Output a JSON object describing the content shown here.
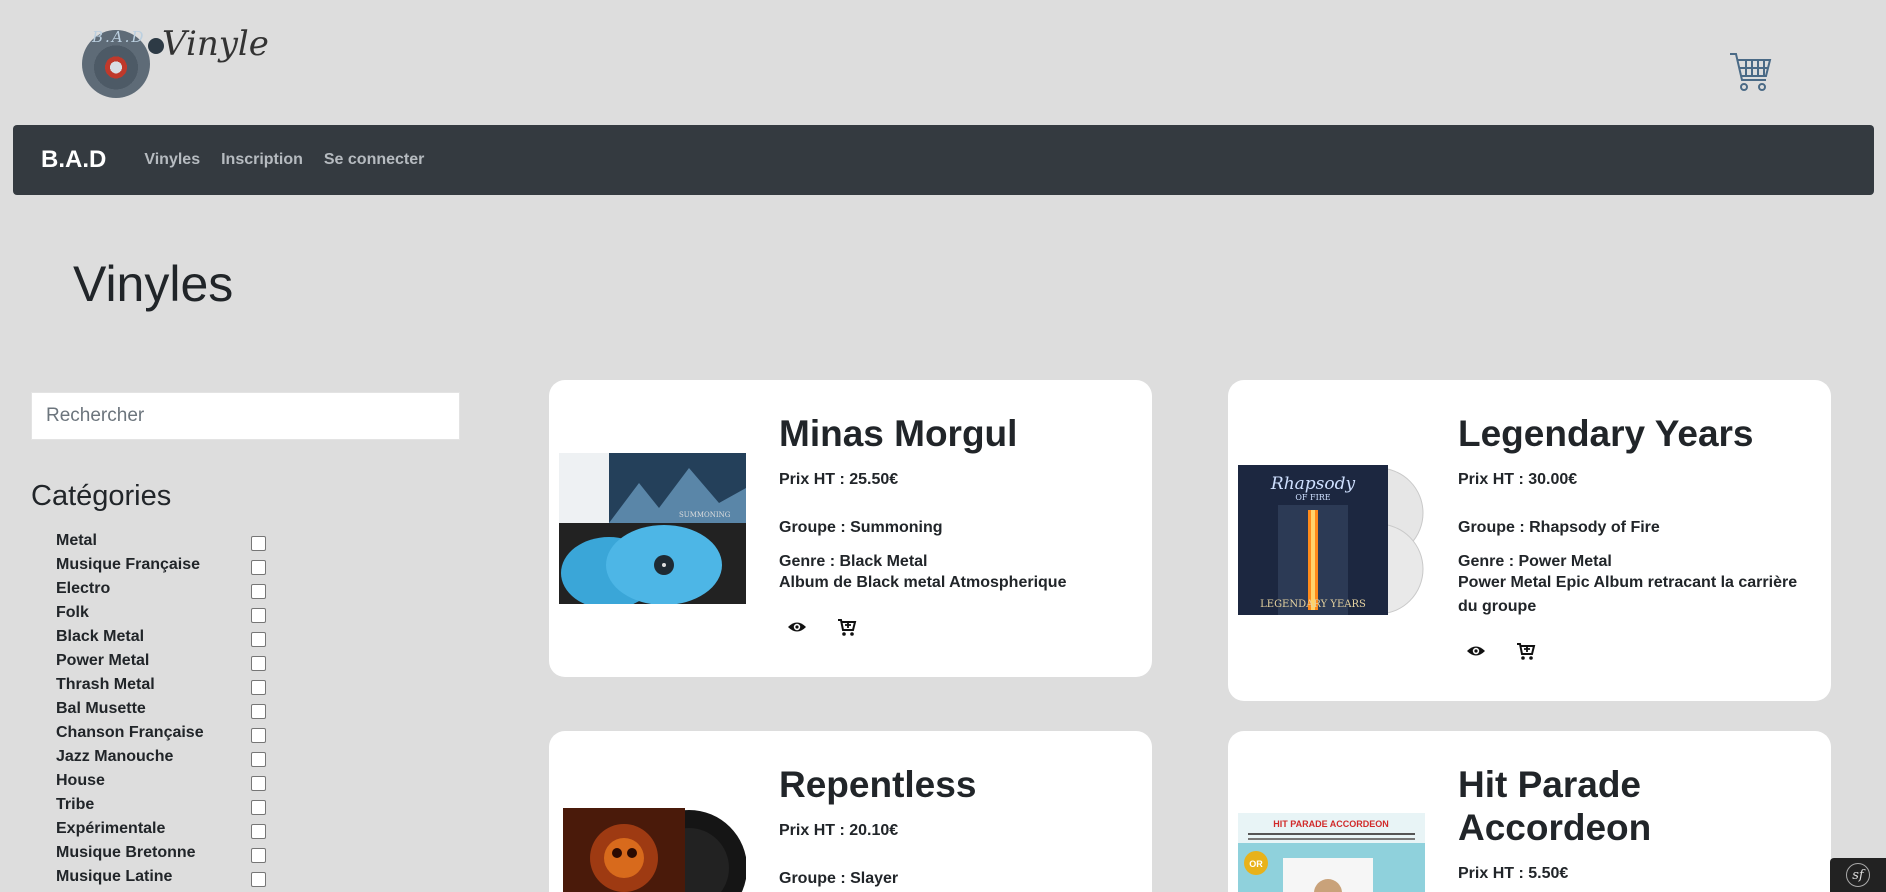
{
  "header": {
    "logo_disc_text": "B.A.D",
    "logo_word": "Vinyle"
  },
  "navbar": {
    "brand": "B.A.D",
    "links": [
      "Vinyles",
      "Inscription",
      "Se connecter"
    ]
  },
  "page_title": "Vinyles",
  "sidebar": {
    "search_placeholder": "Rechercher",
    "categories_title": "Catégories",
    "categories": [
      "Metal",
      "Musique Française",
      "Electro",
      "Folk",
      "Black Metal",
      "Power Metal",
      "Thrash Metal",
      "Bal Musette",
      "Chanson Française",
      "Jazz Manouche",
      "House",
      "Tribe",
      "Expérimentale",
      "Musique Bretonne",
      "Musique Latine"
    ]
  },
  "products": [
    {
      "title": "Minas Morgul",
      "price": "Prix HT : 25.50€",
      "group": "Groupe : Summoning",
      "genre": "Genre : Black Metal",
      "description": "Album de Black metal Atmospherique",
      "cover_text": "SUMMONING"
    },
    {
      "title": "Legendary Years",
      "price": "Prix HT : 30.00€",
      "group": "Groupe : Rhapsody of Fire",
      "genre": "Genre : Power Metal",
      "description": "Power Metal Epic Album retracant la carrière du groupe",
      "cover_text": "Rhapsody",
      "cover_sub": "OF FIRE",
      "cover_bottom": "LEGENDARY YEARS"
    },
    {
      "title": "Repentless",
      "price": "Prix HT : 20.10€",
      "group": "Groupe : Slayer",
      "genre": "",
      "description": ""
    },
    {
      "title": "Hit Parade Accordeon",
      "price": "Prix HT : 5.50€",
      "group": "",
      "genre": "",
      "description": "",
      "cover_text": "HIT PARADE ACCORDEON",
      "cover_badge": "OR"
    }
  ],
  "footer": {
    "symfony_badge": "sf"
  },
  "colors": {
    "background": "#dddddd",
    "navbar": "#343a40",
    "card": "#ffffff"
  }
}
